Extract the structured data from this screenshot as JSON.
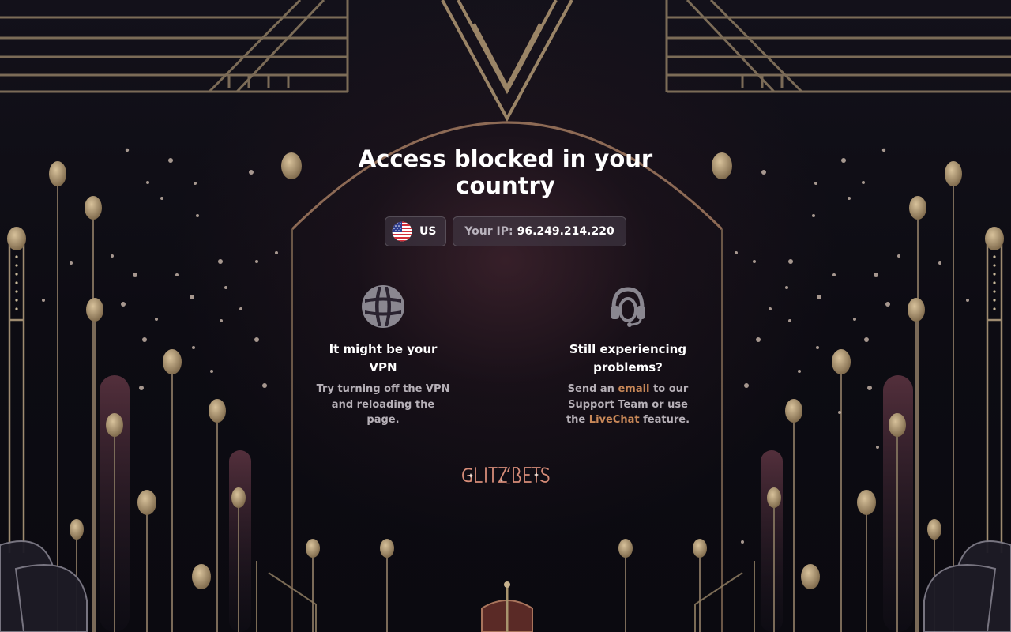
{
  "page": {
    "title": "Access blocked in your country"
  },
  "location": {
    "country_code": "US",
    "flag_icon": "us-flag-icon",
    "ip_label": "Your IP:",
    "ip_value": "96.249.214.220"
  },
  "tips": [
    {
      "icon": "globe-icon",
      "title": "It might be your VPN",
      "text": "Try turning off the VPN and reloading the page."
    },
    {
      "icon": "headset-icon",
      "title": "Still experiencing problems?",
      "text_before": "Send an",
      "email_link": "email",
      "text_middle": "to our Support Team or use the",
      "livechat_link": "LiveChat",
      "text_after": "feature."
    }
  ],
  "brand": {
    "logo_text": "GLITZ BETS"
  },
  "colors": {
    "background": "#0c0b12",
    "accent_link": "#c98858",
    "gold_deco": "#a8946e",
    "rose_glow": "#582e3a",
    "logo": "#d68c78"
  }
}
